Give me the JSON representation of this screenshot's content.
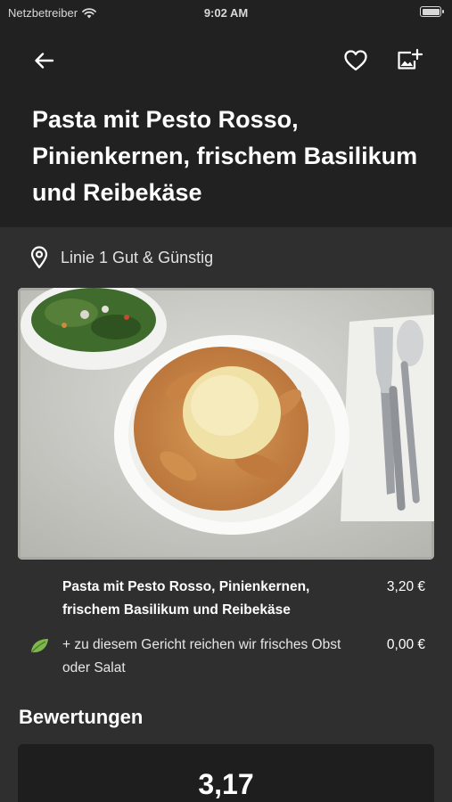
{
  "status_bar": {
    "carrier": "Netzbetreiber",
    "time": "9:02 AM"
  },
  "header": {
    "back_icon": "arrow-left-icon",
    "favorite_icon": "heart-outline-icon",
    "add_photo_icon": "add-photo-icon",
    "title": "Pasta mit Pesto Rosso, Pinienkernen, frischem Basilikum und Reibekäse"
  },
  "location": {
    "icon": "map-pin-icon",
    "name": "Linie 1 Gut & Günstig"
  },
  "items": [
    {
      "name": "Pasta mit Pesto Rosso, Pinienkernen, frischem Basilikum und Reibekäse",
      "price": "3,20 €",
      "icon": ""
    },
    {
      "name": "+ zu diesem Gericht reichen wir frisches Obst oder Salat",
      "price": "0,00 €",
      "icon": "leaf-icon"
    }
  ],
  "ratings": {
    "title": "Bewertungen",
    "average": "3,17"
  },
  "colors": {
    "header_bg": "#212121",
    "page_bg": "#2f2f2f",
    "card_bg": "#1e1e1e",
    "leaf": "#7fb84a"
  }
}
